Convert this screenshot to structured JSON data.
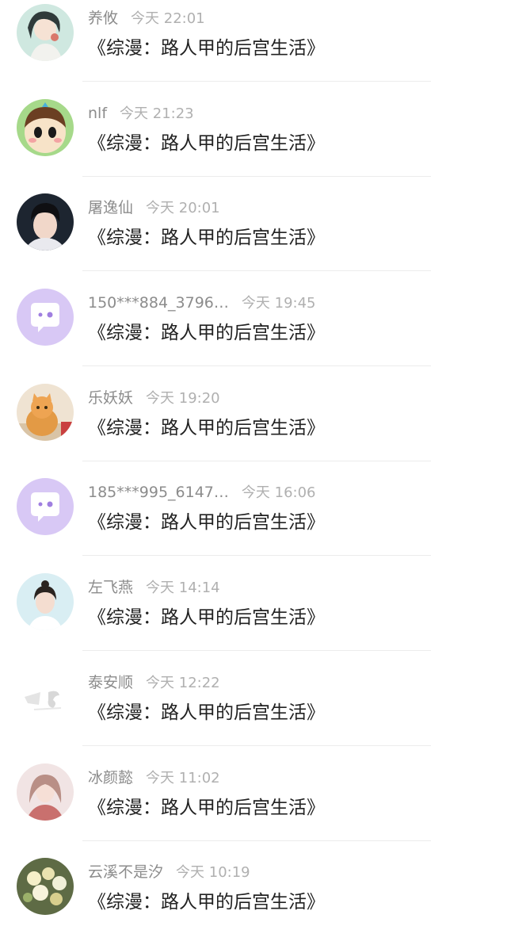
{
  "comments": [
    {
      "username": "养攸",
      "time": "今天 22:01",
      "text": "《综漫：路人甲的后宫生活》",
      "avatar": "girl-drawing-avatar"
    },
    {
      "username": "nlf",
      "time": "今天 21:23",
      "text": "《综漫：路人甲的后宫生活》",
      "avatar": "cartoon-boy-avatar"
    },
    {
      "username": "屠逸仙",
      "time": "今天 20:01",
      "text": "《综漫：路人甲的后宫生活》",
      "avatar": "young-man-photo-avatar"
    },
    {
      "username": "150***884_3796…",
      "time": "今天 19:45",
      "text": "《综漫：路人甲的后宫生活》",
      "avatar": "default-chat-bubble-avatar"
    },
    {
      "username": "乐妖妖",
      "time": "今天 19:20",
      "text": "《综漫：路人甲的后宫生活》",
      "avatar": "orange-cat-avatar"
    },
    {
      "username": "185***995_6147…",
      "time": "今天 16:06",
      "text": "《综漫：路人甲的后宫生活》",
      "avatar": "default-chat-bubble-avatar"
    },
    {
      "username": "左飞燕",
      "time": "今天 14:14",
      "text": "《综漫：路人甲的后宫生活》",
      "avatar": "woman-photo-avatar"
    },
    {
      "username": "泰安顺",
      "time": "今天 12:22",
      "text": "《综漫：路人甲的后宫生活》",
      "avatar": "faded-logo-avatar"
    },
    {
      "username": "冰颜懿",
      "time": "今天 11:02",
      "text": "《综漫：路人甲的后宫生活》",
      "avatar": "painted-girl-avatar"
    },
    {
      "username": "云溪不是汐",
      "time": "今天 10:19",
      "text": "《综漫：路人甲的后宫生活》",
      "avatar": "flower-bouquet-avatar"
    }
  ]
}
